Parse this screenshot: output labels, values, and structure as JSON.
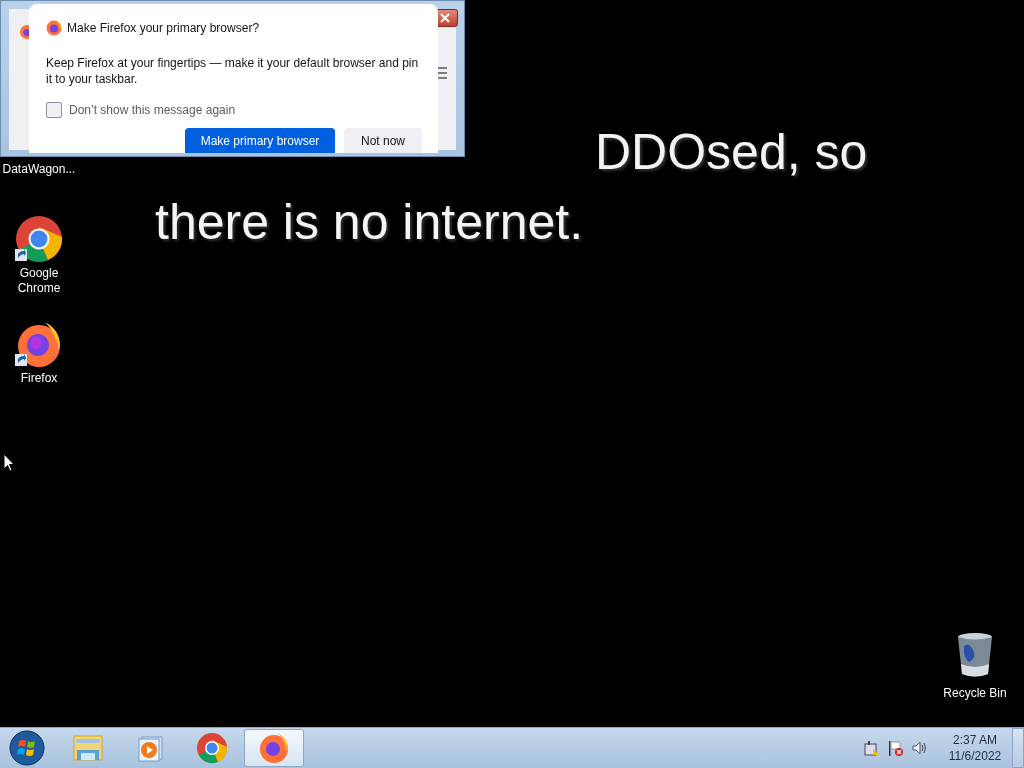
{
  "browser_window": {
    "dialog": {
      "title": "Make Firefox your primary browser?",
      "message": "Keep Firefox at your fingertips — make it your default browser and pin it to your taskbar.",
      "checkbox": {
        "label": "Don’t show this message again",
        "checked": false
      },
      "buttons": [
        {
          "label": "Make primary browser",
          "kind": "primary"
        },
        {
          "label": "Not now",
          "kind": "secondary"
        }
      ]
    }
  },
  "wallpaper": {
    "lines": [
      "DDOsed, so",
      "there is no internet."
    ]
  },
  "desktop_icons": [
    {
      "label": "DataWagon...",
      "kind": "hidden"
    },
    {
      "label": "Google Chrome",
      "kind": "chrome"
    },
    {
      "label": "Firefox",
      "kind": "firefox"
    }
  ],
  "recycle_bin": {
    "label": "Recycle Bin"
  },
  "taskbar": {
    "items": [
      {
        "kind": "explorer",
        "selected": false
      },
      {
        "kind": "media",
        "selected": false
      },
      {
        "kind": "chrome",
        "selected": false
      },
      {
        "kind": "firefox",
        "selected": true
      }
    ],
    "clock": {
      "time": "2:37 AM",
      "date": "11/6/2022"
    }
  }
}
